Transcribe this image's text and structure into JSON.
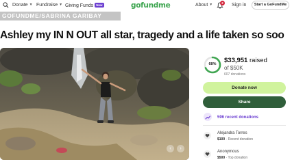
{
  "nav": {
    "donate": "Donate",
    "fundraise": "Fundraise",
    "giving_funds": "Giving Funds",
    "new_badge": "New",
    "about": "About",
    "notification_count": "2",
    "sign_in": "Sign in",
    "start_label": "Start a GoFundMe",
    "logo": "gofundme"
  },
  "banner": "GOFUNDME/SABRINA GARIBAY",
  "title": "Ashley my IN N OUT all star, tragedy and a life taken so soo",
  "donation_card": {
    "progress_percent": "68%",
    "progress_fraction": 0.68,
    "raised": "$33,951",
    "raised_suffix": "raised",
    "goal": "of $50K",
    "donation_count": "607 donations",
    "donate_label": "Donate now",
    "share_label": "Share",
    "recent_donations": "596 recent donations",
    "donors": [
      {
        "name": "Alejandra Torres",
        "amount": "$100",
        "note": "Recent donation"
      },
      {
        "name": "Anonymous",
        "amount": "$500",
        "note": "Top donation"
      }
    ]
  },
  "colors": {
    "brand_green": "#3fa651",
    "donate_button": "#d0f39d",
    "share_button": "#2f5e3a",
    "accent_purple": "#6c3fd1",
    "badge_red": "#d3253b"
  },
  "icons": {
    "search": "search-icon",
    "bell": "bell-icon",
    "trend": "trend-up-icon",
    "donor": "heart-icon"
  }
}
